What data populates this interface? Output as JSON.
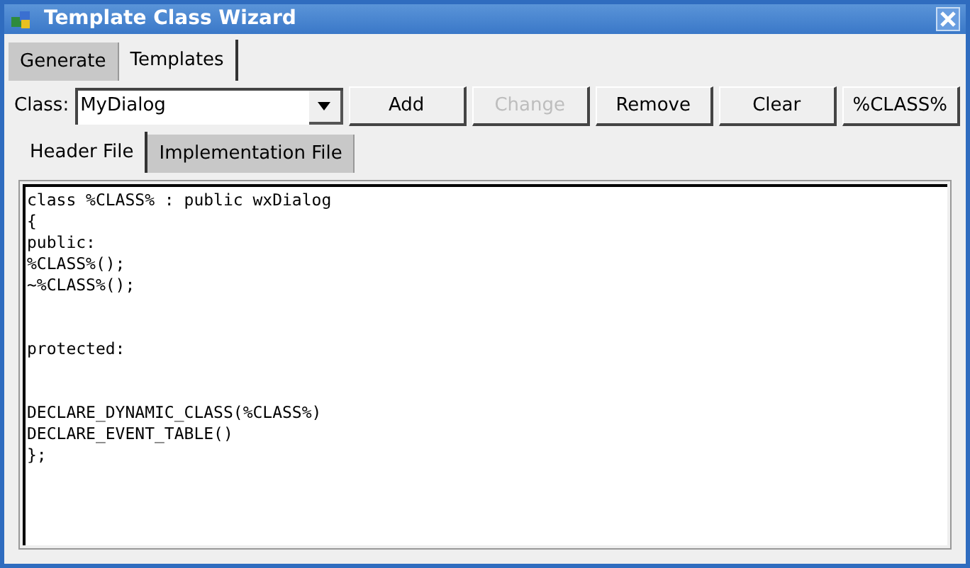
{
  "window": {
    "title": "Template Class Wizard"
  },
  "tabs": [
    {
      "label": "Generate",
      "selected": false
    },
    {
      "label": "Templates",
      "selected": true
    }
  ],
  "class_field": {
    "label": "Class:",
    "value": "MyDialog"
  },
  "buttons": [
    {
      "label": "Add",
      "disabled": false
    },
    {
      "label": "Change",
      "disabled": true
    },
    {
      "label": "Remove",
      "disabled": false
    },
    {
      "label": "Clear",
      "disabled": false
    },
    {
      "label": "%CLASS%",
      "disabled": false
    }
  ],
  "file_tabs": [
    {
      "label": "Header File",
      "selected": true
    },
    {
      "label": "Implementation File",
      "selected": false
    }
  ],
  "editor": {
    "value": "class %CLASS% : public wxDialog\n{\npublic:\n%CLASS%();\n~%CLASS%();\n\n\nprotected:\n\n\nDECLARE_DYNAMIC_CLASS(%CLASS%)\nDECLARE_EVENT_TABLE()\n};"
  }
}
